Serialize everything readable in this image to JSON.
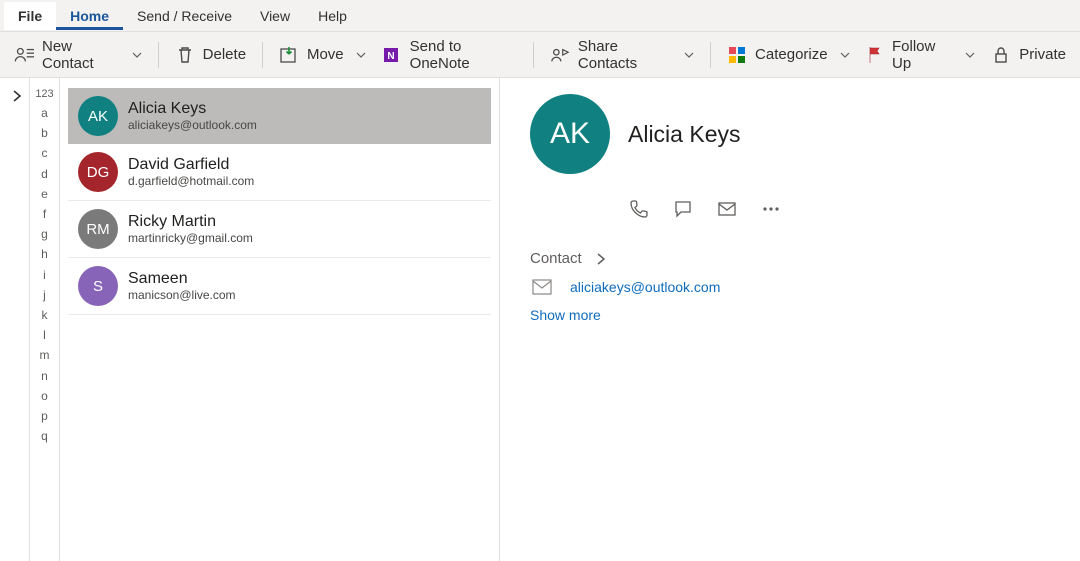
{
  "menu": {
    "file": "File",
    "home": "Home",
    "sendreceive": "Send / Receive",
    "view": "View",
    "help": "Help"
  },
  "toolbar": {
    "new_contact": "New Contact",
    "delete": "Delete",
    "move": "Move",
    "onenote": "Send to OneNote",
    "share": "Share Contacts",
    "categorize": "Categorize",
    "followup": "Follow Up",
    "private": "Private"
  },
  "alpha": {
    "header": "123",
    "letters": [
      "a",
      "b",
      "c",
      "d",
      "e",
      "f",
      "g",
      "h",
      "i",
      "j",
      "k",
      "l",
      "m",
      "n",
      "o",
      "p",
      "q"
    ]
  },
  "contacts": [
    {
      "initials": "AK",
      "name": "Alicia Keys",
      "email": "aliciakeys@outlook.com",
      "color": "c-teal",
      "selected": true
    },
    {
      "initials": "DG",
      "name": "David Garfield",
      "email": "d.garfield@hotmail.com",
      "color": "c-red",
      "selected": false
    },
    {
      "initials": "RM",
      "name": "Ricky Martin",
      "email": "martinricky@gmail.com",
      "color": "c-gray",
      "selected": false
    },
    {
      "initials": "S",
      "name": "Sameen",
      "email": "manicson@live.com",
      "color": "c-purple",
      "selected": false
    }
  ],
  "detail": {
    "initials": "AK",
    "name": "Alicia Keys",
    "section_label": "Contact",
    "email": "aliciakeys@outlook.com",
    "show_more": "Show more"
  }
}
